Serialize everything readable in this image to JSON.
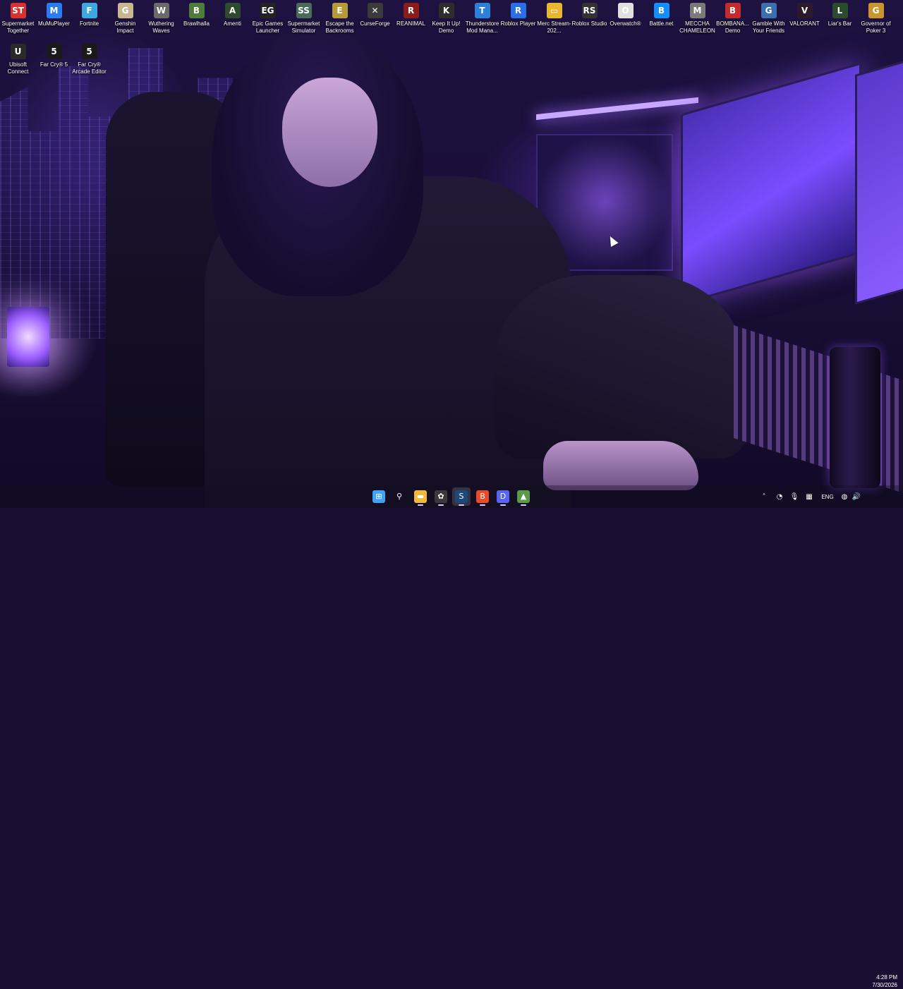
{
  "desktop": {
    "icons": [
      {
        "label": "Supermarket Together",
        "glyph": "ST",
        "color": "#d93131",
        "icon": "supermarket-together-icon"
      },
      {
        "label": "MuMuPlayer",
        "glyph": "M",
        "color": "#2b7cf0",
        "icon": "mumuplayer-icon"
      },
      {
        "label": "Fortnite",
        "glyph": "F",
        "color": "#3da8e0",
        "icon": "fortnite-icon"
      },
      {
        "label": "Genshin Impact",
        "glyph": "G",
        "color": "#c9b88f",
        "icon": "genshin-impact-icon"
      },
      {
        "label": "Wuthering Waves",
        "glyph": "W",
        "color": "#6a6a6a",
        "icon": "wuthering-waves-icon"
      },
      {
        "label": "Brawlhalla",
        "glyph": "B",
        "color": "#4f7c3a",
        "icon": "brawlhalla-icon"
      },
      {
        "label": "Amenti",
        "glyph": "A",
        "color": "#2f4b2f",
        "icon": "amenti-icon"
      },
      {
        "label": "Epic Games Launcher",
        "glyph": "EG",
        "color": "#222222",
        "icon": "epic-games-icon"
      },
      {
        "label": "Supermarket Simulator",
        "glyph": "SS",
        "color": "#4a6b5a",
        "icon": "supermarket-simulator-icon"
      },
      {
        "label": "Escape the Backrooms",
        "glyph": "E",
        "color": "#b59a3a",
        "icon": "escape-backrooms-icon"
      },
      {
        "label": "CurseForge",
        "glyph": "✕",
        "color": "#3a3a3a",
        "icon": "curseforge-icon"
      },
      {
        "label": "REANIMAL",
        "glyph": "R",
        "color": "#8a1c1c",
        "icon": "reanimal-icon"
      },
      {
        "label": "Keep It Up! Demo",
        "glyph": "K",
        "color": "#2d2d2d",
        "icon": "keep-it-up-icon"
      },
      {
        "label": "Thunderstore Mod Mana...",
        "glyph": "T",
        "color": "#2c80d8",
        "icon": "thunderstore-icon"
      },
      {
        "label": "Roblox Player",
        "glyph": "R",
        "color": "#2a6ee8",
        "icon": "roblox-player-icon"
      },
      {
        "label": "Merc Stream-202...",
        "glyph": "▭",
        "color": "#e8b730",
        "icon": "folder-icon"
      },
      {
        "label": "Roblox Studio",
        "glyph": "RS",
        "color": "#333333",
        "icon": "roblox-studio-icon"
      },
      {
        "label": "Overwatch®",
        "glyph": "O",
        "color": "#e0e0e0",
        "icon": "overwatch-icon"
      },
      {
        "label": "Battle.net",
        "glyph": "B",
        "color": "#148eff",
        "icon": "battlenet-icon"
      },
      {
        "label": "MECCHA CHAMELEON",
        "glyph": "M",
        "color": "#7a7a7a",
        "icon": "meccha-chameleon-icon"
      },
      {
        "label": "BOMBANA... Demo",
        "glyph": "B",
        "color": "#c22c2c",
        "icon": "bombana-icon"
      },
      {
        "label": "Gamble With Your Friends",
        "glyph": "G",
        "color": "#3b6fb0",
        "icon": "gamble-icon"
      },
      {
        "label": "VALORANT",
        "glyph": "V",
        "color": "#2a1a2a",
        "icon": "valorant-icon"
      },
      {
        "label": "Liar's Bar",
        "glyph": "L",
        "color": "#2c4b2c",
        "icon": "liars-bar-icon"
      },
      {
        "label": "Governor of Poker 3",
        "glyph": "G",
        "color": "#c8962c",
        "icon": "governor-poker-icon"
      },
      {
        "label": "Ubisoft Connect",
        "glyph": "U",
        "color": "#2a2a2a",
        "icon": "ubisoft-connect-icon"
      },
      {
        "label": "Far Cry® 5",
        "glyph": "5",
        "color": "#1a1a1a",
        "icon": "far-cry-5-icon"
      },
      {
        "label": "Far Cry® Arcade Editor",
        "glyph": "5",
        "color": "#1a1a1a",
        "icon": "far-cry-arcade-icon"
      }
    ]
  },
  "taskbar": {
    "apps": [
      {
        "name": "start",
        "glyph": "⊞",
        "color": "#3fa2f7",
        "icon": "windows-start-icon"
      },
      {
        "name": "search",
        "glyph": "⚲",
        "color": "transparent",
        "icon": "search-icon"
      },
      {
        "name": "file-explorer",
        "glyph": "▬",
        "color": "#f0b93a",
        "icon": "file-explorer-icon"
      },
      {
        "name": "chatgpt",
        "glyph": "✿",
        "color": "#3a3a3a",
        "icon": "chatgpt-icon"
      },
      {
        "name": "steam",
        "glyph": "S",
        "color": "#1b4a7a",
        "icon": "steam-icon"
      },
      {
        "name": "brave",
        "glyph": "B",
        "color": "#e84a2a",
        "icon": "brave-browser-icon"
      },
      {
        "name": "discord",
        "glyph": "D",
        "color": "#5865f2",
        "icon": "discord-icon"
      },
      {
        "name": "app",
        "glyph": "▲",
        "color": "#5a9a4a",
        "icon": "green-app-icon"
      }
    ],
    "tray": {
      "language": "ENG",
      "time": "4:28 PM",
      "date": "7/30/2026"
    }
  }
}
